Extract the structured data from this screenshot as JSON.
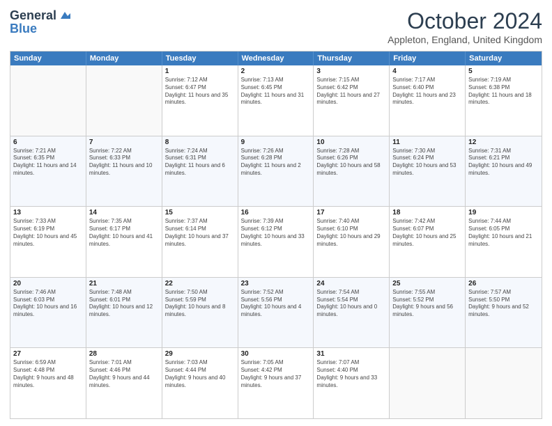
{
  "logo": {
    "line1": "General",
    "line2": "Blue"
  },
  "title": "October 2024",
  "location": "Appleton, England, United Kingdom",
  "days_of_week": [
    "Sunday",
    "Monday",
    "Tuesday",
    "Wednesday",
    "Thursday",
    "Friday",
    "Saturday"
  ],
  "weeks": [
    [
      {
        "day": "",
        "info": ""
      },
      {
        "day": "",
        "info": ""
      },
      {
        "day": "1",
        "info": "Sunrise: 7:12 AM\nSunset: 6:47 PM\nDaylight: 11 hours and 35 minutes."
      },
      {
        "day": "2",
        "info": "Sunrise: 7:13 AM\nSunset: 6:45 PM\nDaylight: 11 hours and 31 minutes."
      },
      {
        "day": "3",
        "info": "Sunrise: 7:15 AM\nSunset: 6:42 PM\nDaylight: 11 hours and 27 minutes."
      },
      {
        "day": "4",
        "info": "Sunrise: 7:17 AM\nSunset: 6:40 PM\nDaylight: 11 hours and 23 minutes."
      },
      {
        "day": "5",
        "info": "Sunrise: 7:19 AM\nSunset: 6:38 PM\nDaylight: 11 hours and 18 minutes."
      }
    ],
    [
      {
        "day": "6",
        "info": "Sunrise: 7:21 AM\nSunset: 6:35 PM\nDaylight: 11 hours and 14 minutes."
      },
      {
        "day": "7",
        "info": "Sunrise: 7:22 AM\nSunset: 6:33 PM\nDaylight: 11 hours and 10 minutes."
      },
      {
        "day": "8",
        "info": "Sunrise: 7:24 AM\nSunset: 6:31 PM\nDaylight: 11 hours and 6 minutes."
      },
      {
        "day": "9",
        "info": "Sunrise: 7:26 AM\nSunset: 6:28 PM\nDaylight: 11 hours and 2 minutes."
      },
      {
        "day": "10",
        "info": "Sunrise: 7:28 AM\nSunset: 6:26 PM\nDaylight: 10 hours and 58 minutes."
      },
      {
        "day": "11",
        "info": "Sunrise: 7:30 AM\nSunset: 6:24 PM\nDaylight: 10 hours and 53 minutes."
      },
      {
        "day": "12",
        "info": "Sunrise: 7:31 AM\nSunset: 6:21 PM\nDaylight: 10 hours and 49 minutes."
      }
    ],
    [
      {
        "day": "13",
        "info": "Sunrise: 7:33 AM\nSunset: 6:19 PM\nDaylight: 10 hours and 45 minutes."
      },
      {
        "day": "14",
        "info": "Sunrise: 7:35 AM\nSunset: 6:17 PM\nDaylight: 10 hours and 41 minutes."
      },
      {
        "day": "15",
        "info": "Sunrise: 7:37 AM\nSunset: 6:14 PM\nDaylight: 10 hours and 37 minutes."
      },
      {
        "day": "16",
        "info": "Sunrise: 7:39 AM\nSunset: 6:12 PM\nDaylight: 10 hours and 33 minutes."
      },
      {
        "day": "17",
        "info": "Sunrise: 7:40 AM\nSunset: 6:10 PM\nDaylight: 10 hours and 29 minutes."
      },
      {
        "day": "18",
        "info": "Sunrise: 7:42 AM\nSunset: 6:07 PM\nDaylight: 10 hours and 25 minutes."
      },
      {
        "day": "19",
        "info": "Sunrise: 7:44 AM\nSunset: 6:05 PM\nDaylight: 10 hours and 21 minutes."
      }
    ],
    [
      {
        "day": "20",
        "info": "Sunrise: 7:46 AM\nSunset: 6:03 PM\nDaylight: 10 hours and 16 minutes."
      },
      {
        "day": "21",
        "info": "Sunrise: 7:48 AM\nSunset: 6:01 PM\nDaylight: 10 hours and 12 minutes."
      },
      {
        "day": "22",
        "info": "Sunrise: 7:50 AM\nSunset: 5:59 PM\nDaylight: 10 hours and 8 minutes."
      },
      {
        "day": "23",
        "info": "Sunrise: 7:52 AM\nSunset: 5:56 PM\nDaylight: 10 hours and 4 minutes."
      },
      {
        "day": "24",
        "info": "Sunrise: 7:54 AM\nSunset: 5:54 PM\nDaylight: 10 hours and 0 minutes."
      },
      {
        "day": "25",
        "info": "Sunrise: 7:55 AM\nSunset: 5:52 PM\nDaylight: 9 hours and 56 minutes."
      },
      {
        "day": "26",
        "info": "Sunrise: 7:57 AM\nSunset: 5:50 PM\nDaylight: 9 hours and 52 minutes."
      }
    ],
    [
      {
        "day": "27",
        "info": "Sunrise: 6:59 AM\nSunset: 4:48 PM\nDaylight: 9 hours and 48 minutes."
      },
      {
        "day": "28",
        "info": "Sunrise: 7:01 AM\nSunset: 4:46 PM\nDaylight: 9 hours and 44 minutes."
      },
      {
        "day": "29",
        "info": "Sunrise: 7:03 AM\nSunset: 4:44 PM\nDaylight: 9 hours and 40 minutes."
      },
      {
        "day": "30",
        "info": "Sunrise: 7:05 AM\nSunset: 4:42 PM\nDaylight: 9 hours and 37 minutes."
      },
      {
        "day": "31",
        "info": "Sunrise: 7:07 AM\nSunset: 4:40 PM\nDaylight: 9 hours and 33 minutes."
      },
      {
        "day": "",
        "info": ""
      },
      {
        "day": "",
        "info": ""
      }
    ]
  ]
}
